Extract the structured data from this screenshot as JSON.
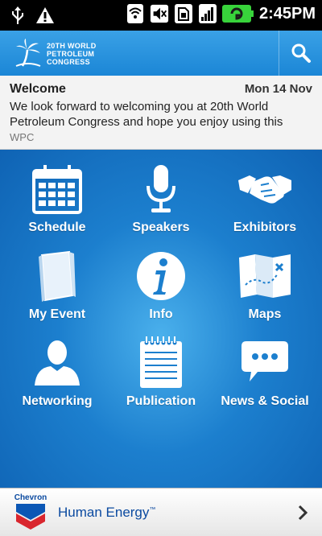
{
  "status_bar": {
    "time": "2:45PM",
    "icons": [
      "usb-icon",
      "warning-icon",
      "wifi-icon",
      "mute-icon",
      "sim-icon",
      "signal-icon",
      "battery-icon"
    ],
    "battery_color": "#38d33b"
  },
  "header": {
    "logo_lines": [
      "20TH WORLD",
      "PETROLEUM",
      "CONGRESS"
    ],
    "accent": "#2592de"
  },
  "welcome": {
    "title": "Welcome",
    "date": "Mon 14 Nov",
    "message": "We look forward to welcoming you at 20th World Petroleum Congress and hope you enjoy using this",
    "source": "WPC"
  },
  "dashboard": {
    "tiles": [
      {
        "label": "Schedule",
        "icon": "calendar-icon"
      },
      {
        "label": "Speakers",
        "icon": "microphone-icon"
      },
      {
        "label": "Exhibitors",
        "icon": "handshake-icon"
      },
      {
        "label": "My Event",
        "icon": "book-icon"
      },
      {
        "label": "Info",
        "icon": "info-icon"
      },
      {
        "label": "Maps",
        "icon": "map-icon"
      },
      {
        "label": "Networking",
        "icon": "person-icon"
      },
      {
        "label": "Publication",
        "icon": "notepad-icon"
      },
      {
        "label": "News & Social",
        "icon": "chat-bubble-icon"
      }
    ]
  },
  "banner": {
    "brand": "Chevron",
    "tagline": "Human Energy",
    "trademark": "™"
  }
}
